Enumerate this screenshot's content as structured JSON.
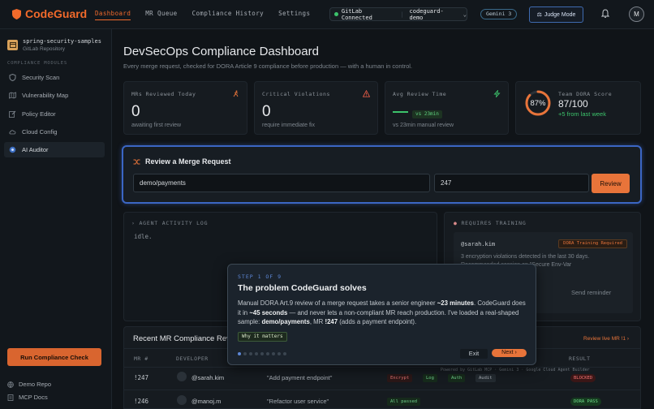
{
  "app": {
    "name": "CodeGuard",
    "nav": [
      "Dashboard",
      "MR Queue",
      "Compliance History",
      "Settings"
    ],
    "gitlab_status": "GitLab Connected",
    "project": "codeguard-demo",
    "model": "Gemini 3",
    "judge_mode": "Judge Mode",
    "user_initial": "M",
    "accent": "#f26a2b"
  },
  "sidebar": {
    "repo_name": "spring-security-samples",
    "repo_type": "GitLab Repository",
    "section": "COMPLIANCE MODULES",
    "items": [
      {
        "label": "Security Scan",
        "icon": "shield-icon"
      },
      {
        "label": "Vulnerability Map",
        "icon": "map-icon"
      },
      {
        "label": "Policy Editor",
        "icon": "edit-icon"
      },
      {
        "label": "Cloud Config",
        "icon": "cloud-icon"
      },
      {
        "label": "AI Auditor",
        "icon": "robot-icon"
      }
    ],
    "run_button": "Run Compliance Check",
    "demo_repo": "Demo Repo",
    "mcp_docs": "MCP Docs"
  },
  "main": {
    "title": "DevSecOps Compliance Dashboard",
    "subtitle": "Every merge request, checked for DORA Article 9 compliance before production — with a human in control."
  },
  "stats": [
    {
      "label": "MRs Reviewed Today",
      "value": "0",
      "sub": "awaiting first review"
    },
    {
      "label": "Critical Violations",
      "value": "0",
      "sub": "require immediate fix"
    },
    {
      "label": "Avg Review Time",
      "value": "",
      "badge": "vs 23min",
      "sub": "vs 23min manual review"
    },
    {
      "label": "Team DORA Score",
      "value": "87/100",
      "ring": "87%",
      "sub": "+5 from last week",
      "score": 87
    }
  ],
  "review": {
    "title": "Review a Merge Request",
    "repo_value": "demo/payments",
    "mr_value": "247",
    "button": "Review"
  },
  "activity": {
    "label": "AGENT ACTIVITY LOG",
    "status": "idle."
  },
  "training": {
    "label": "REQUIRES TRAINING",
    "user": "@sarah.kim",
    "badge": "DORA Training Required",
    "text_line1": "3 encryption violations detected in the last 30 days.",
    "text_line2": "Recommended session on \"Secure Env-Var",
    "send": "Send reminder"
  },
  "recent": {
    "title": "Recent MR Compliance Reviews",
    "link": "Review live MR !1 ›",
    "headers": [
      "MR #",
      "DEVELOPER",
      "",
      "",
      "RESULT"
    ],
    "powered": "Powered by GitLab MCP · Gemini 3 · Google Cloud Agent Builder",
    "rows": [
      {
        "mr": "!247",
        "dev": "@sarah.kim",
        "title": "\"Add payment endpoint\"",
        "checks": [
          "Encrypt",
          "Log",
          "Auth",
          "Audit"
        ],
        "result": "BLOCKED"
      },
      {
        "mr": "!246",
        "dev": "@manoj.m",
        "title": "\"Refactor user service\"",
        "checks": [
          "All passed"
        ],
        "result": "DORA PASS"
      }
    ]
  },
  "tour": {
    "step": "STEP 1 OF 9",
    "title": "The problem CodeGuard solves",
    "body_1": "Manual DORA Art.9 review of a merge request takes a senior engineer ",
    "body_1b": "~23 minutes",
    "body_2": ". CodeGuard does it in ",
    "body_2b": "~45 seconds",
    "body_3": " — and never lets a non-compliant MR reach production. I've loaded a real-shaped sample: ",
    "body_3b": "demo/payments",
    "body_4": ", MR ",
    "body_4b": "!247",
    "body_5": " (adds a payment endpoint).",
    "why": "Why it matters",
    "exit": "Exit",
    "next": "Next ›",
    "total_steps": 9,
    "current_step": 1
  }
}
